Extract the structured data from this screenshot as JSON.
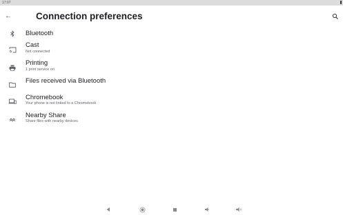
{
  "status_bar": {
    "time": "17:07"
  },
  "header": {
    "title": "Connection preferences",
    "back_icon": "arrow-back-icon",
    "search_icon": "search-icon"
  },
  "items": [
    {
      "title": "Bluetooth",
      "subtitle": "",
      "icon": "bluetooth-icon"
    },
    {
      "title": "Cast",
      "subtitle": "Not connected",
      "icon": "cast-icon"
    },
    {
      "title": "Printing",
      "subtitle": "1 print service on",
      "icon": "printer-icon"
    },
    {
      "title": "Files received via Bluetooth",
      "subtitle": "",
      "icon": "folder-icon"
    },
    {
      "title": "Chromebook",
      "subtitle": "Your phone is not linked to a Chromebook",
      "icon": "chromebook-icon"
    },
    {
      "title": "Nearby Share",
      "subtitle": "Share files with nearby devices",
      "icon": "nearby-share-icon"
    }
  ],
  "nav_bar": [
    "back-triangle-icon",
    "home-circle-icon",
    "recents-square-icon",
    "volume-down-icon",
    "volume-up-icon"
  ],
  "colors": {
    "background": "#ffffff",
    "status_bar": "#dcdcdc",
    "text_primary": "#202124",
    "text_secondary": "#5f6368",
    "icon": "#5f6368"
  }
}
